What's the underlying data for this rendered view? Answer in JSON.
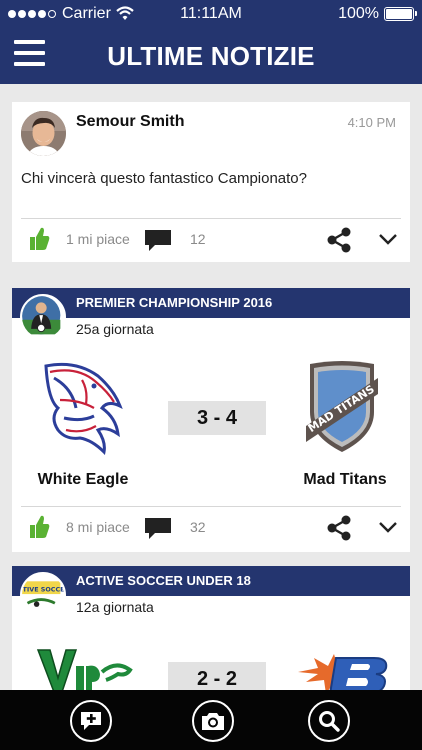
{
  "status_bar": {
    "carrier": "Carrier",
    "time": "11:11AM",
    "battery": "100%",
    "signal_bars": 4,
    "battery_level": 1.0
  },
  "header": {
    "title": "ULTIME NOTIZIE"
  },
  "post": {
    "author": "Semour Smith",
    "time": "4:10 PM",
    "text": "Chi vincerà questo fantastico Campionato?",
    "likes": "1 mi piace",
    "comments": "12"
  },
  "matches": [
    {
      "league": "PREMIER CHAMPIONSHIP 2016",
      "round": "25a giornata",
      "score": "3 - 4",
      "home_team": "White Eagle",
      "away_team": "Mad Titans",
      "away_logo_text": "MAD TITANS",
      "likes": "8 mi piace",
      "comments": "32"
    },
    {
      "league": "ACTIVE SOCCER UNDER 18",
      "round": "12a giornata",
      "score": "2 - 2",
      "league_logo_text": "ACTIVE SOCCER"
    }
  ],
  "colors": {
    "nav": "#24356f",
    "like_green": "#5ab233",
    "background": "#e9e9e9",
    "tabbar": "#050505"
  },
  "icons": [
    "menu-icon",
    "like-icon",
    "comment-icon",
    "share-icon",
    "chevron-down-icon",
    "add-message-icon",
    "camera-icon",
    "search-icon"
  ]
}
